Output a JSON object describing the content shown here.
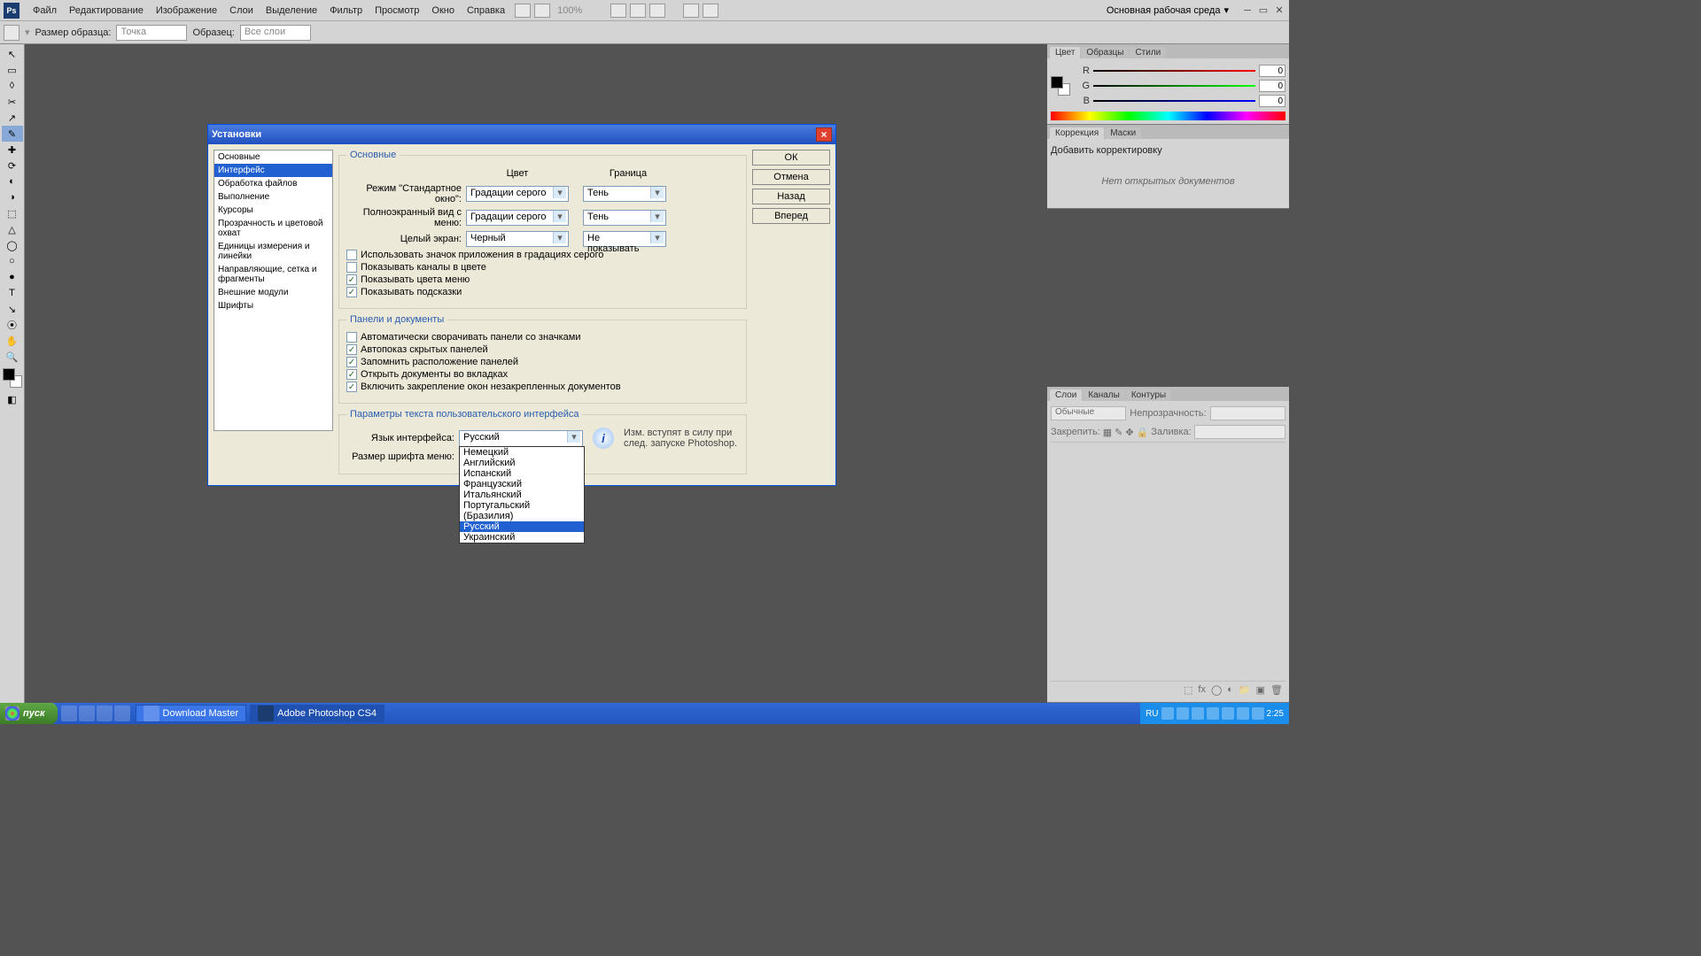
{
  "menu": [
    "Файл",
    "Редактирование",
    "Изображение",
    "Слои",
    "Выделение",
    "Фильтр",
    "Просмотр",
    "Окно",
    "Справка"
  ],
  "workspace": "Основная рабочая среда",
  "zoom": "100%",
  "optbar": {
    "label1": "Размер образца:",
    "val1": "Точка",
    "label2": "Образец:",
    "val2": "Все слои"
  },
  "toolbar": [
    "↖",
    "▭",
    "◊",
    "✂",
    "↗",
    "✎",
    "✚",
    "⟳",
    "◐",
    "◑",
    "⬚",
    "△",
    "◯",
    "○",
    "●",
    "⦿",
    "T",
    "↘",
    "✋",
    "🔍"
  ],
  "panels": {
    "color": {
      "tabs": [
        "Цвет",
        "Образцы",
        "Стили"
      ],
      "rgb": {
        "R": "0",
        "G": "0",
        "B": "0"
      }
    },
    "adjust": {
      "tabs": [
        "Коррекция",
        "Маски"
      ],
      "add": "Добавить корректировку",
      "empty": "Нет открытых документов"
    },
    "layers": {
      "tabs": [
        "Слои",
        "Каналы",
        "Контуры"
      ],
      "mode": "Обычные",
      "opacityLbl": "Непрозрачность:",
      "lockLbl": "Закрепить:",
      "fillLbl": "Заливка:"
    }
  },
  "dialog": {
    "title": "Установки",
    "nav": [
      "Основные",
      "Интерфейс",
      "Обработка файлов",
      "Выполнение",
      "Курсоры",
      "Прозрачность и цветовой охват",
      "Единицы измерения и линейки",
      "Направляющие, сетка и фрагменты",
      "Внешние модули",
      "Шрифты"
    ],
    "navSelected": 1,
    "btns": [
      "ОК",
      "Отмена",
      "Назад",
      "Вперед"
    ],
    "section1": {
      "legend": "Основные",
      "colHdr1": "Цвет",
      "colHdr2": "Граница",
      "row1Lbl": "Режим \"Стандартное окно\":",
      "row1V1": "Градации серого",
      "row1V2": "Тень",
      "row2Lbl": "Полноэкранный вид с меню:",
      "row2V1": "Градации серого",
      "row2V2": "Тень",
      "row3Lbl": "Целый экран:",
      "row3V1": "Черный",
      "row3V2": "Не показывать",
      "chk1": "Использовать значок приложения в градациях серого",
      "chk2": "Показывать каналы в цвете",
      "chk3": "Показывать цвета меню",
      "chk4": "Показывать подсказки"
    },
    "section2": {
      "legend": "Панели и документы",
      "chk1": "Автоматически сворачивать панели со значками",
      "chk2": "Автопоказ скрытых панелей",
      "chk3": "Запомнить расположение панелей",
      "chk4": "Открыть документы во вкладках",
      "chk5": "Включить закрепление окон незакрепленных документов"
    },
    "section3": {
      "legend": "Параметры текста пользовательского интерфейса",
      "langLbl": "Язык интерфейса:",
      "langCur": "Русский",
      "langOpts": [
        "Немецкий",
        "Английский",
        "Испанский",
        "Французский",
        "Итальянский",
        "Португальский (Бразилия)",
        "Русский",
        "Украинский"
      ],
      "langHighlight": 6,
      "sizeLbl": "Размер шрифта меню:",
      "info": "Изм. вступят в силу при след. запуске Photoshop."
    }
  },
  "taskbar": {
    "start": "пуск",
    "items": [
      "Download Master",
      "Adobe Photoshop CS4"
    ],
    "active": 1,
    "lang": "RU",
    "time": "2:25"
  }
}
